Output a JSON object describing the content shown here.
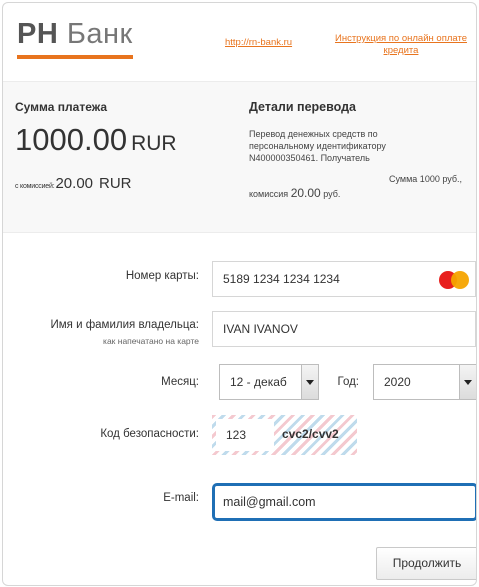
{
  "header": {
    "logo_rh": "РН",
    "logo_bank": "Банк",
    "site_link": "http://rn-bank.ru",
    "instruction_link": "Инструкция по онлайн оплате кредита",
    "accent_color": "#e8741e"
  },
  "summary": {
    "payment_title": "Сумма платежа",
    "amount": "1000.00",
    "currency": "RUR",
    "commission_label": "с комиссией:",
    "commission_amount": "20.00",
    "commission_currency": "RUR",
    "details_title": "Детали перевода",
    "details_text": "Перевод денежных средств по персональному идентификатору N400000350461. Получатель",
    "details_sum": "Сумма 1000 руб.,",
    "details_commission_prefix": "комиссия",
    "details_commission_value": "20.00",
    "details_commission_suffix": "руб."
  },
  "form": {
    "card_label": "Номер карты:",
    "card_number": "5189 1234 1234 1234",
    "card_brand_icon": "mastercard-icon",
    "holder_label": "Имя и фамилия владельца:",
    "holder_sublabel": "как напечатано на карте",
    "holder_name": "IVAN IVANOV",
    "month_label": "Месяц:",
    "month_value": "12 - декаб",
    "year_label": "Год:",
    "year_value": "2020",
    "cvc_label": "Код безопасности:",
    "cvc_value": "123",
    "cvc_hint": "cvc2/cvv2",
    "email_label": "E-mail:",
    "email_value": "mail@gmail.com",
    "focus_color": "#1f6fb5"
  },
  "actions": {
    "continue_label": "Продолжить"
  }
}
